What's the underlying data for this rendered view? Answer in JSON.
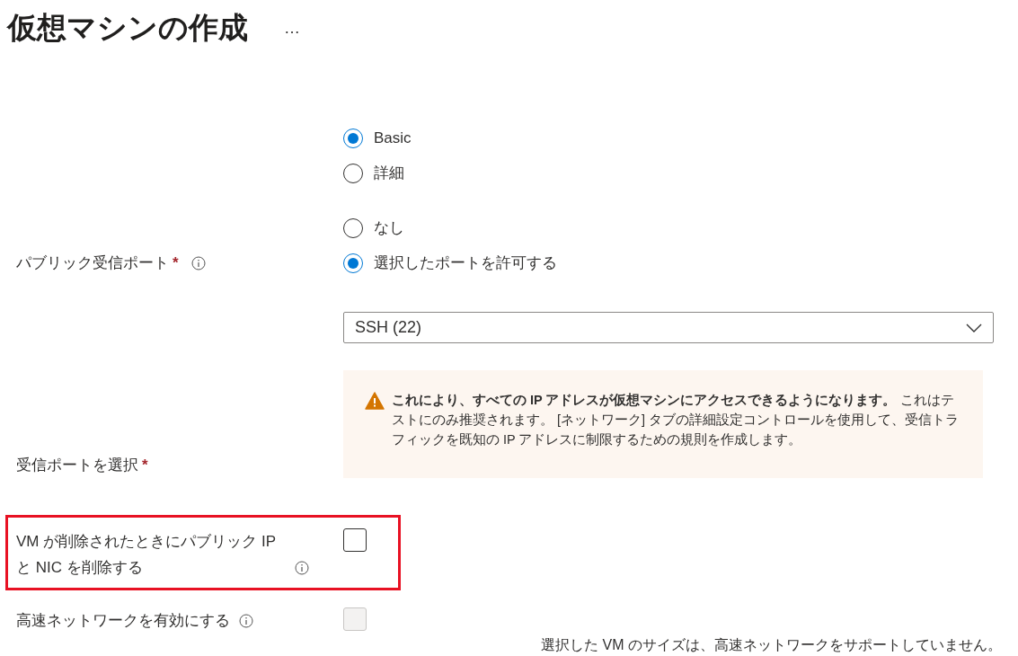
{
  "page": {
    "title": "仮想マシンの作成",
    "more": "…"
  },
  "fields": [
    {
      "kind": "radio",
      "options": [
        {
          "label": "Basic",
          "selected": true
        },
        {
          "label": "詳細",
          "selected": false
        }
      ]
    },
    {
      "kind": "radio",
      "label": "パブリック受信ポート",
      "required_mark": "*",
      "info": true,
      "options": [
        {
          "label": "なし",
          "selected": false
        },
        {
          "label": "選択したポートを許可する",
          "selected": true
        }
      ]
    },
    {
      "kind": "select",
      "label": "受信ポートを選択",
      "required_mark": "*",
      "value": "SSH (22)",
      "warning": "**これにより、すべての IP アドレスが仮想マシンにアクセスできるようになります。** これはテストにのみ推奨されます。 [ネットワーク] タブの詳細設定コントロールを使用して、受信トラフィックを既知の IP アドレスに制限するための規則を作成します。"
    },
    {
      "kind": "checkbox",
      "label": "VM が削除されたときにパブリック IP と NIC を削除する",
      "info": true,
      "checked": false,
      "disabled": false,
      "highlighted": true
    },
    {
      "kind": "checkbox",
      "label": "高速ネットワークを有効にする",
      "info": true,
      "checked": false,
      "disabled": true,
      "note": "選択した VM のサイズは、高速ネットワークをサポートしていません。"
    }
  ]
}
